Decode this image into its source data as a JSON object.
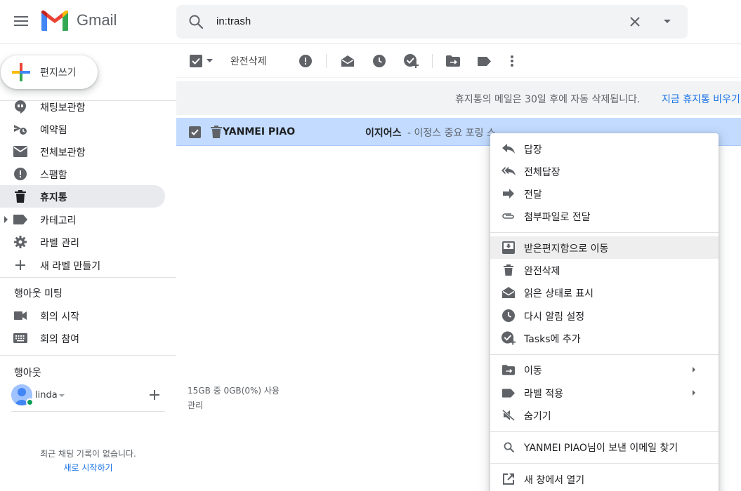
{
  "header": {
    "app_name": "Gmail",
    "search_value": "in:trash"
  },
  "sidebar": {
    "compose_label": "편지쓰기",
    "items": [
      {
        "label": "채팅보관함",
        "icon": "chat-bubble-icon"
      },
      {
        "label": "예약됨",
        "icon": "scheduled-icon"
      },
      {
        "label": "전체보관함",
        "icon": "mail-icon"
      },
      {
        "label": "스팸함",
        "icon": "spam-icon"
      },
      {
        "label": "휴지통",
        "icon": "trash-icon",
        "active": true
      },
      {
        "label": "카테고리",
        "icon": "label-icon"
      },
      {
        "label": "라벨 관리",
        "icon": "gear-icon"
      },
      {
        "label": "새 라벨 만들기",
        "icon": "plus-icon"
      }
    ],
    "meet_title": "행아웃 미팅",
    "meet_items": [
      {
        "label": "회의 시작",
        "icon": "video-icon"
      },
      {
        "label": "회의 참여",
        "icon": "keyboard-icon"
      }
    ],
    "hangouts_title": "행아웃",
    "user_name": "linda",
    "no_chat_text": "최근 채팅 기록이 없습니다.",
    "start_link": "새로 시작하기"
  },
  "toolbar": {
    "delete_forever": "완전삭제"
  },
  "banner": {
    "text": "휴지통의 메일은 30일 후에 자동 삭제됩니다.",
    "link": "지금 휴지통 비우기"
  },
  "mail": {
    "sender": "YANMEI PIAO",
    "subject": "이지어스",
    "snippet": " - 이정스 중요 포링 스"
  },
  "footer": {
    "storage": "15GB 중 0GB(0%) 사용",
    "manage": "관리"
  },
  "context_menu": {
    "items": [
      {
        "label": "답장",
        "icon": "reply-icon"
      },
      {
        "label": "전체답장",
        "icon": "reply-all-icon"
      },
      {
        "label": "전달",
        "icon": "forward-icon"
      },
      {
        "label": "첨부파일로 전달",
        "icon": "attachment-icon"
      },
      {
        "label": "받은편지함으로 이동",
        "icon": "move-to-inbox-icon",
        "hover": true
      },
      {
        "label": "완전삭제",
        "icon": "trash-icon"
      },
      {
        "label": "읽은 상태로 표시",
        "icon": "mark-read-icon"
      },
      {
        "label": "다시 알림 설정",
        "icon": "snooze-icon"
      },
      {
        "label": "Tasks에 추가",
        "icon": "add-task-icon"
      },
      {
        "label": "이동",
        "icon": "move-to-icon",
        "submenu": true
      },
      {
        "label": "라벨 적용",
        "icon": "label-icon",
        "submenu": true
      },
      {
        "label": "숨기기",
        "icon": "mute-icon"
      },
      {
        "label": "YANMEI PIAO님이 보낸 이메일 찾기",
        "icon": "search-icon"
      },
      {
        "label": "새 창에서 열기",
        "icon": "open-new-window-icon"
      }
    ]
  },
  "colors": {
    "selected_row": "#c2dbff",
    "link": "#1a73e8",
    "active_nav": "#e8eaed",
    "icon_gray": "#5f6368"
  }
}
